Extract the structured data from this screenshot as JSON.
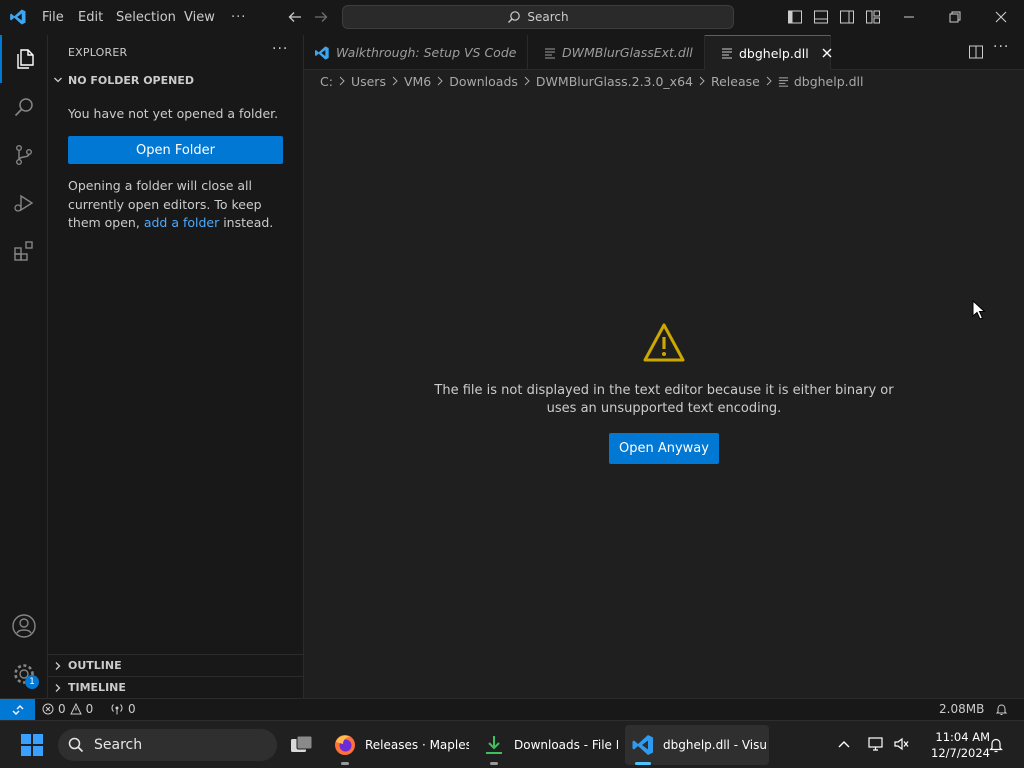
{
  "titlebar": {
    "menu": [
      "File",
      "Edit",
      "Selection",
      "View"
    ],
    "more": "···",
    "search_label": "Search"
  },
  "sidebar": {
    "header": "EXPLORER",
    "more": "···",
    "section": "NO FOLDER OPENED",
    "message": "You have not yet opened a folder.",
    "open_folder_label": "Open Folder",
    "hint_before": "Opening a folder will close all currently open editors. To keep them open, ",
    "hint_link": "add a folder",
    "hint_after": " instead.",
    "outline": "OUTLINE",
    "timeline": "TIMELINE",
    "accounts_badge": "1"
  },
  "tabs": [
    {
      "label": "Walkthrough: Setup VS Code",
      "icon": "vscode-icon",
      "active": false
    },
    {
      "label": "DWMBlurGlassExt.dll",
      "icon": "file-lines-icon",
      "active": false
    },
    {
      "label": "dbghelp.dll",
      "icon": "file-lines-icon",
      "active": true
    }
  ],
  "breadcrumb": [
    "C:",
    "Users",
    "VM6",
    "Downloads",
    "DWMBlurGlass.2.3.0_x64",
    "Release",
    "dbghelp.dll"
  ],
  "editor": {
    "message": "The file is not displayed in the text editor because it is either binary or uses an unsupported text encoding.",
    "open_anyway_label": "Open Anyway"
  },
  "statusbar": {
    "errors": "0",
    "warnings": "0",
    "ports": "0",
    "filesize": "2.08MB"
  },
  "taskbar": {
    "search_label": "Search",
    "apps": [
      {
        "label": "Releases · Maplesp",
        "icon": "firefox-icon"
      },
      {
        "label": "Downloads - File E",
        "icon": "download-icon"
      },
      {
        "label": "dbghelp.dll - Visu",
        "icon": "vscode-icon"
      }
    ],
    "time": "11:04 AM",
    "date": "12/7/2024"
  },
  "colors": {
    "accent": "#0078d4",
    "warning": "#cca700",
    "link": "#4daafc"
  }
}
